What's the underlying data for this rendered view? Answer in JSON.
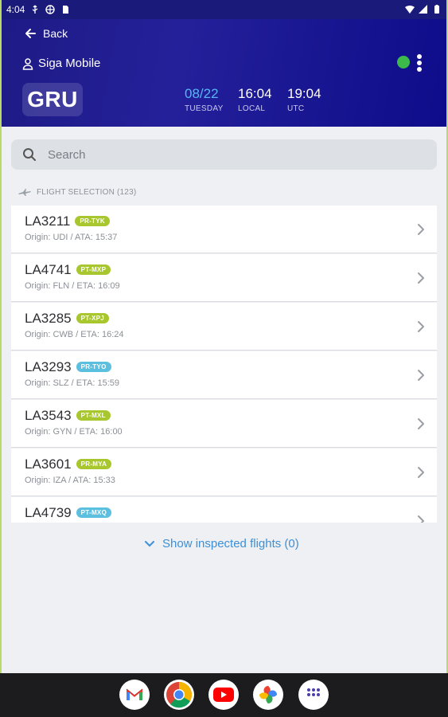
{
  "status_bar": {
    "time": "4:04"
  },
  "header": {
    "back_label": "Back",
    "user_name": "Siga Mobile",
    "airport_code": "GRU",
    "date": "08/22",
    "weekday": "TUESDAY",
    "local_time": "16:04",
    "local_label": "LOCAL",
    "utc_time": "19:04",
    "utc_label": "UTC"
  },
  "search": {
    "placeholder": "Search"
  },
  "section": {
    "label": "FLIGHT SELECTION (123)"
  },
  "flights": [
    {
      "code": "LA3211",
      "registration": "PR-TYK",
      "info": "Origin: UDI / ATA: 15:37",
      "badge_color": "#a8c62d"
    },
    {
      "code": "LA4741",
      "registration": "PT-MXP",
      "info": "Origin: FLN / ETA: 16:09",
      "badge_color": "#a8c62d"
    },
    {
      "code": "LA3285",
      "registration": "PT-XPJ",
      "info": "Origin: CWB / ETA: 16:24",
      "badge_color": "#a8c62d"
    },
    {
      "code": "LA3293",
      "registration": "PR-TYO",
      "info": "Origin: SLZ / ETA: 15:59",
      "badge_color": "#5bbfe0"
    },
    {
      "code": "LA3543",
      "registration": "PT-MXL",
      "info": "Origin: GYN / ETA: 16:00",
      "badge_color": "#a8c62d"
    },
    {
      "code": "LA3601",
      "registration": "PR-MYA",
      "info": "Origin: IZA / ATA: 15:33",
      "badge_color": "#a8c62d"
    },
    {
      "code": "LA4739",
      "registration": "PT-MXQ",
      "info": "",
      "badge_color": "#5bbfe0"
    }
  ],
  "show_inspected": {
    "label": "Show inspected flights (0)"
  },
  "colors": {
    "header_bg": "#1e1b86",
    "accent_blue": "#3d8fd6",
    "status_online": "#3db84b"
  },
  "dock": {
    "apps": [
      "gmail-icon",
      "chrome-icon",
      "youtube-icon",
      "photos-icon",
      "app-drawer-icon"
    ]
  }
}
